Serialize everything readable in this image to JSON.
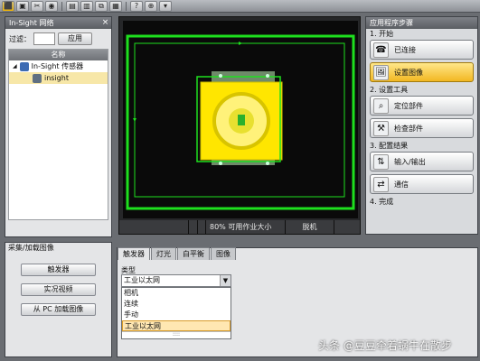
{
  "toolbar": {
    "buttons": [
      {
        "icon": "connect-icon",
        "glyph": "⬛",
        "active": true
      },
      {
        "icon": "folder-icon",
        "glyph": "▣"
      },
      {
        "icon": "cut-icon",
        "glyph": "✂"
      },
      {
        "icon": "camera-icon",
        "glyph": "◉"
      },
      {
        "icon": "save-icon",
        "glyph": "▤"
      },
      {
        "icon": "open-icon",
        "glyph": "▥"
      },
      {
        "icon": "copy-icon",
        "glyph": "⧉"
      },
      {
        "icon": "paste-icon",
        "glyph": "▦"
      },
      {
        "icon": "help-icon",
        "glyph": "?"
      },
      {
        "icon": "info-icon",
        "glyph": "⊕"
      },
      {
        "icon": "dropdown-icon",
        "glyph": "▾"
      }
    ]
  },
  "network_panel": {
    "title": "In-Sight 网络",
    "close_glyph": "×",
    "filter_label": "过滤：",
    "filter_value": "",
    "apply_button": "应用",
    "tree_header": "名称",
    "tree_items": [
      {
        "label": "In-Sight 传感器",
        "expander": "◢",
        "selected": false
      },
      {
        "label": "insight",
        "selected": true
      }
    ]
  },
  "view": {
    "status_label": "80% 可用作业大小",
    "mode_label": "脱机"
  },
  "steps_panel": {
    "title": "应用程序步骤",
    "sections": [
      {
        "label": "1. 开始",
        "buttons": [
          {
            "label": "已连接",
            "icon": "connected-icon",
            "glyph": "☎"
          },
          {
            "label": "设置图像",
            "icon": "image-setup-icon",
            "glyph": "🖼",
            "active": true
          }
        ]
      },
      {
        "label": "2. 设置工具",
        "buttons": [
          {
            "label": "定位部件",
            "icon": "locate-icon",
            "glyph": "⌕"
          },
          {
            "label": "检查部件",
            "icon": "inspect-icon",
            "glyph": "⚒"
          }
        ]
      },
      {
        "label": "3. 配置结果",
        "buttons": [
          {
            "label": "输入/输出",
            "icon": "io-icon",
            "glyph": "⇅"
          },
          {
            "label": "通信",
            "icon": "comm-icon",
            "glyph": "⇄"
          }
        ]
      },
      {
        "label": "4. 完成",
        "buttons": []
      }
    ]
  },
  "acquisition_panel": {
    "title": "采集/加载图像",
    "buttons": [
      "触发器",
      "实况视频",
      "从 PC 加载图像"
    ]
  },
  "tabs": {
    "items": [
      "触发器",
      "灯光",
      "白平衡",
      "图像"
    ],
    "active_index": 0
  },
  "trigger_settings": {
    "type_label": "类型",
    "selected_value": "工业以太网",
    "options": [
      "相机",
      "连续",
      "手动",
      "工业以太网"
    ],
    "highlighted_index": 3,
    "grip": "::::"
  },
  "watermark": "头条 @豆豆牵着蜗牛在散步",
  "colors": {
    "overlay_green": "#1ee01e",
    "part_yellow": "#ffe600",
    "accent_orange": "#f2b722"
  }
}
